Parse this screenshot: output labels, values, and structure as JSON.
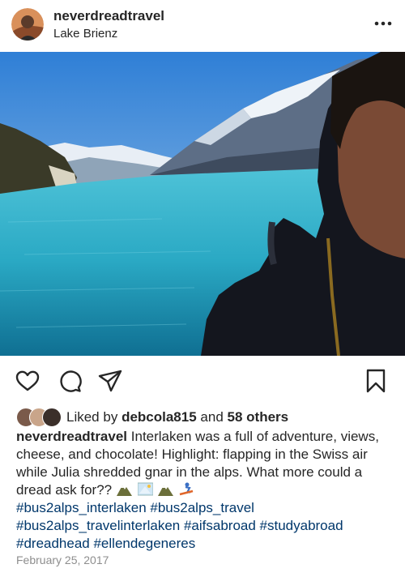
{
  "post": {
    "username": "neverdreadtravel",
    "location": "Lake Brienz"
  },
  "likes": {
    "prefix": "Liked by",
    "user": "debcola815",
    "middle": "and",
    "others": "58 others"
  },
  "caption": {
    "username": "neverdreadtravel",
    "text": "Interlaken was a full of adventure, views, cheese, and chocolate! Highlight: flapping in the Swiss air while Julia shredded gnar in the alps. What more could a dread ask for??",
    "hashtags": "#bus2alps_interlaken #bus2alps_travel #bus2alps_travelinterlaken #aifsabroad #studyabroad #dreadhead #ellendegeneres"
  },
  "date": "February 25, 2017",
  "icons": [
    "more-icon",
    "heart-icon",
    "comment-icon",
    "share-icon",
    "bookmark-icon",
    "mountain-emoji",
    "snowboarder-emoji"
  ],
  "colors": {
    "text": "#262626",
    "hashtag": "#00376b",
    "date": "#8e8e8e",
    "lake": "#2aa9c4",
    "sky": "#3f8fd8"
  }
}
